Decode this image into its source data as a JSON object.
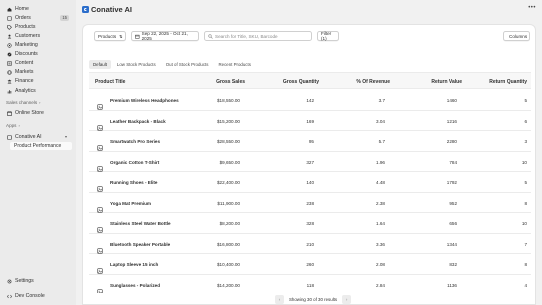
{
  "sidebar": {
    "items": [
      {
        "label": "Home",
        "icon": "home-icon"
      },
      {
        "label": "Orders",
        "icon": "orders-icon",
        "badge": "15"
      },
      {
        "label": "Products",
        "icon": "tag-icon"
      },
      {
        "label": "Customers",
        "icon": "person-icon"
      },
      {
        "label": "Marketing",
        "icon": "target-icon"
      },
      {
        "label": "Discounts",
        "icon": "discount-icon"
      },
      {
        "label": "Content",
        "icon": "content-icon"
      },
      {
        "label": "Markets",
        "icon": "globe-icon"
      },
      {
        "label": "Finance",
        "icon": "bank-icon"
      },
      {
        "label": "Analytics",
        "icon": "chart-icon"
      }
    ],
    "sales_channels_label": "Sales channels",
    "online_store_label": "Online Store",
    "apps_label": "Apps",
    "app_name": "Conative AI",
    "app_sub_item": "Product Performance",
    "settings_label": "Settings",
    "dev_console_label": "Dev Console"
  },
  "header": {
    "title": "Conative AI",
    "more": "•••"
  },
  "filters": {
    "products_label": "Products",
    "date_range": "Sep 22, 2025 - Oct 21, 2025",
    "search_placeholder": "Search for Title, SKU, Barcode",
    "filter_label": "Filter (1)",
    "columns_label": "Columns"
  },
  "tabs": [
    "Default",
    "Low Stock Products",
    "Out of Stock Products",
    "Recent Products"
  ],
  "table": {
    "columns": [
      "Product Title",
      "Gross Sales",
      "Gross Quantity",
      "% Of Revenue",
      "Return Value",
      "Return Quantity"
    ],
    "rows": [
      [
        "Premium Wireless Headphones",
        "$18,550.00",
        "142",
        "3.7",
        "1460",
        "5"
      ],
      [
        "Leather Backpack - Black",
        "$15,200.00",
        "169",
        "3.04",
        "1216",
        "6"
      ],
      [
        "Smartwatch Pro Series",
        "$28,550.00",
        "95",
        "5.7",
        "2280",
        "3"
      ],
      [
        "Organic Cotton T-Shirt",
        "$9,650.00",
        "327",
        "1.96",
        "784",
        "10"
      ],
      [
        "Running Shoes - Elite",
        "$22,400.00",
        "140",
        "4.48",
        "1792",
        "5"
      ],
      [
        "Yoga Mat Premium",
        "$11,900.00",
        "238",
        "2.38",
        "952",
        "8"
      ],
      [
        "Stainless Steel Water Bottle",
        "$8,200.00",
        "328",
        "1.64",
        "656",
        "10"
      ],
      [
        "Bluetooth Speaker Portable",
        "$16,800.00",
        "210",
        "3.36",
        "1344",
        "7"
      ],
      [
        "Laptop Sleeve 15 inch",
        "$10,400.00",
        "260",
        "2.08",
        "832",
        "8"
      ],
      [
        "Sunglasses - Polarized",
        "$14,200.00",
        "118",
        "2.84",
        "1136",
        "4"
      ]
    ]
  },
  "pagination": {
    "text": "Showing 30 of 30 results",
    "prev": "‹",
    "next": "›"
  }
}
